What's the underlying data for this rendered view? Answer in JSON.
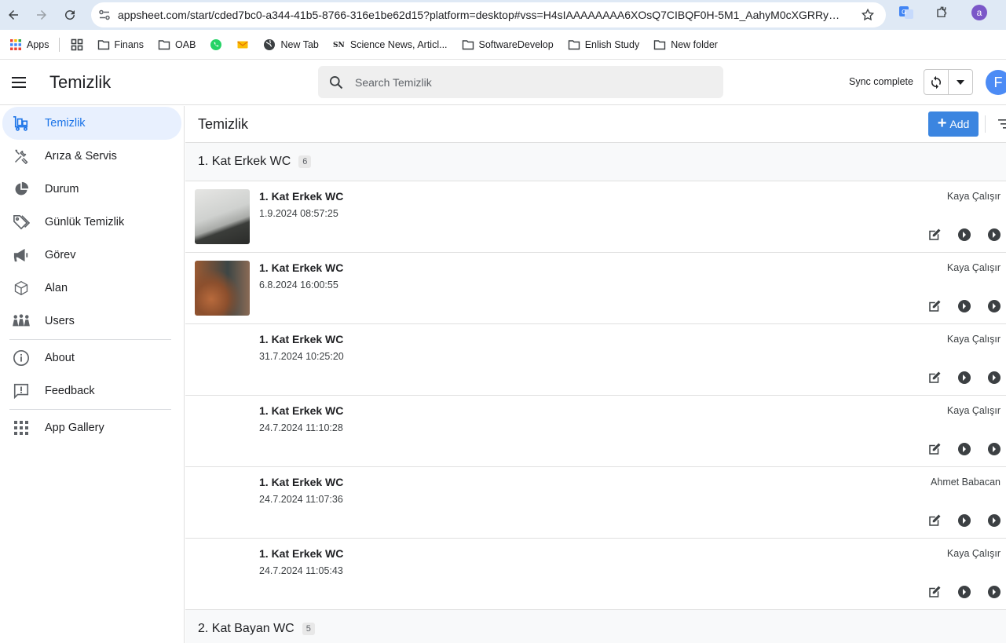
{
  "browser": {
    "url": "appsheet.com/start/cded7bc0-a344-41b5-8766-316e1be62d15?platform=desktop#vss=H4sIAAAAAAAA6XOsQ7CIBQF0H-5M1_AahyM0cXGRRywv...",
    "profile_initial": "a",
    "bookmarks": [
      {
        "label": "Apps",
        "icon": "apps-grid-icon"
      },
      {
        "label": "",
        "icon": "grid-icon"
      },
      {
        "label": "Finans",
        "icon": "folder-icon"
      },
      {
        "label": "OAB",
        "icon": "folder-icon"
      },
      {
        "label": "",
        "icon": "whatsapp-icon"
      },
      {
        "label": "",
        "icon": "mail-icon"
      },
      {
        "label": "New Tab",
        "icon": "globe-icon"
      },
      {
        "label": "Science News, Articl...",
        "icon": "sciencenews-icon"
      },
      {
        "label": "SoftwareDevelop",
        "icon": "folder-icon"
      },
      {
        "label": "Enlish Study",
        "icon": "folder-icon"
      },
      {
        "label": "New folder",
        "icon": "folder-icon"
      }
    ]
  },
  "header": {
    "title": "Temizlik",
    "search_placeholder": "Search Temizlik",
    "sync_status": "Sync complete",
    "user_initial": "F"
  },
  "sidebar": {
    "items": [
      {
        "label": "Temizlik",
        "icon": "cleaning-cart-icon",
        "active": true
      },
      {
        "label": "Arıza & Servis",
        "icon": "tools-icon"
      },
      {
        "label": "Durum",
        "icon": "pie-chart-icon"
      },
      {
        "label": "Günlük Temizlik",
        "icon": "tags-icon"
      },
      {
        "label": "Görev",
        "icon": "megaphone-icon"
      },
      {
        "label": "Alan",
        "icon": "cube-icon"
      },
      {
        "label": "Users",
        "icon": "users-icon"
      }
    ],
    "secondary": [
      {
        "label": "About",
        "icon": "info-icon"
      },
      {
        "label": "Feedback",
        "icon": "feedback-icon"
      }
    ],
    "tertiary": [
      {
        "label": "App Gallery",
        "icon": "app-gallery-icon"
      }
    ]
  },
  "view": {
    "title": "Temizlik",
    "add_label": "Add",
    "groups": [
      {
        "title": "1. Kat Erkek WC",
        "count": "6",
        "rows": [
          {
            "title": "1. Kat Erkek WC",
            "date": "1.9.2024 08:57:25",
            "person": "Kaya Çalışır",
            "thumb": "t1"
          },
          {
            "title": "1. Kat Erkek WC",
            "date": "6.8.2024 16:00:55",
            "person": "Kaya Çalışır",
            "thumb": "t2"
          },
          {
            "title": "1. Kat Erkek WC",
            "date": "31.7.2024 10:25:20",
            "person": "Kaya Çalışır",
            "thumb": ""
          },
          {
            "title": "1. Kat Erkek WC",
            "date": "24.7.2024 11:10:28",
            "person": "Kaya Çalışır",
            "thumb": ""
          },
          {
            "title": "1. Kat Erkek WC",
            "date": "24.7.2024 11:07:36",
            "person": "Ahmet Babacan",
            "thumb": ""
          },
          {
            "title": "1. Kat Erkek WC",
            "date": "24.7.2024 11:05:43",
            "person": "Kaya Çalışır",
            "thumb": ""
          }
        ]
      },
      {
        "title": "2. Kat Bayan WC",
        "count": "5",
        "rows": []
      }
    ]
  }
}
